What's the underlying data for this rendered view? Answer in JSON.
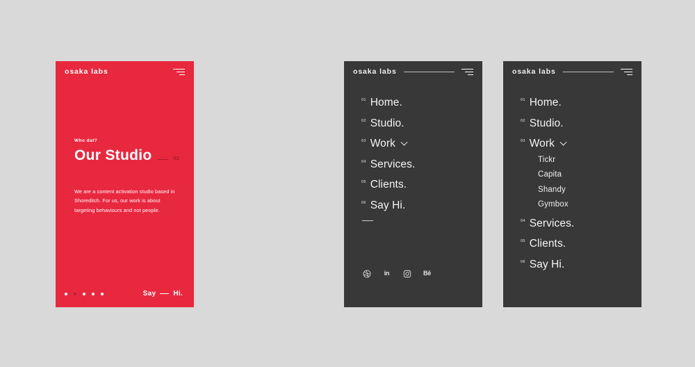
{
  "brand": "osaka labs",
  "hero": {
    "eyebrow": "Who dat?",
    "title": "Our Studio",
    "index": "02",
    "copy": "We are a content activation studio based in Shoreditch. For us, our work is about targeting behaviours and not people.",
    "cta": "Say",
    "cta_end": "Hi.",
    "dots_count": 5,
    "dots_active_index": 1,
    "bg_color": "#e8283f"
  },
  "menu": {
    "bg_color": "#383838",
    "items": [
      {
        "num": "01",
        "label": "Home.",
        "has_chevron": false
      },
      {
        "num": "02",
        "label": "Studio.",
        "has_chevron": false
      },
      {
        "num": "03",
        "label": "Work",
        "has_chevron": true
      },
      {
        "num": "04",
        "label": "Services.",
        "has_chevron": false
      },
      {
        "num": "05",
        "label": "Clients.",
        "has_chevron": false
      },
      {
        "num": "06",
        "label": "Say Hi.",
        "has_chevron": false
      }
    ],
    "work_submenu": [
      "Tickr",
      "Capita",
      "Shandy",
      "Gymbox"
    ],
    "socials": [
      {
        "name": "dribbble-icon",
        "label": ""
      },
      {
        "name": "linkedin-icon",
        "label": "in"
      },
      {
        "name": "instagram-icon",
        "label": ""
      },
      {
        "name": "behance-icon",
        "label": "Bē"
      }
    ]
  }
}
